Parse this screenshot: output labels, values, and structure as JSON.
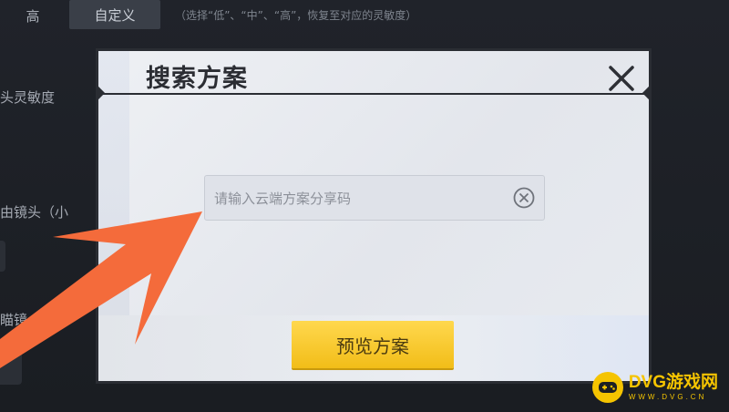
{
  "background": {
    "segments": {
      "high": "高",
      "custom": "自定义",
      "hint": "（选择“低”、“中”、“高”，恢复至对应的灵敏度）"
    },
    "labels": {
      "sensitivity": "头灵敏度",
      "free_camera": "由镜头（小",
      "third": "瞄镜"
    }
  },
  "modal": {
    "title": "搜索方案",
    "search": {
      "placeholder": "请输入云端方案分享码",
      "value": ""
    },
    "preview_button": "预览方案"
  },
  "watermark": {
    "name": "DVG游戏网",
    "url": "WWW.DVG.CN"
  },
  "colors": {
    "accent_yellow": "#f5c400",
    "arrow_orange": "#f46b3b",
    "modal_bg": "#e8ebf0",
    "dark_bg": "#1c1f24"
  },
  "icons": {
    "close": "close-icon",
    "clear": "clear-circle-icon",
    "watermark_logo": "gamepad-logo-icon",
    "pointer": "arrow-pointer-icon"
  }
}
